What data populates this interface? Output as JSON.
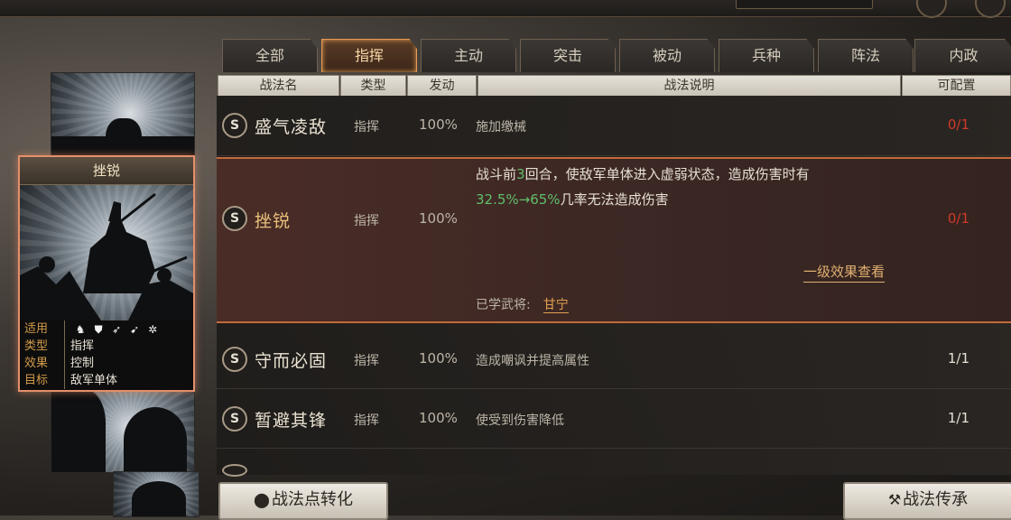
{
  "tabs": [
    {
      "label": "全部"
    },
    {
      "label": "指挥"
    },
    {
      "label": "主动"
    },
    {
      "label": "突击"
    },
    {
      "label": "被动"
    },
    {
      "label": "兵种"
    },
    {
      "label": "阵法"
    },
    {
      "label": "内政"
    }
  ],
  "active_tab": "指挥",
  "headers": {
    "name": "战法名",
    "type": "类型",
    "rate": "发动",
    "desc": "战法说明",
    "config": "可配置"
  },
  "card": {
    "title": "挫锐",
    "info": [
      {
        "label": "适用",
        "value": ""
      },
      {
        "label": "类型",
        "value": "指挥"
      },
      {
        "label": "效果",
        "value": "控制"
      },
      {
        "label": "目标",
        "value": "敌军单体"
      }
    ],
    "arm_icons": [
      "cavalry-icon",
      "shield-icon",
      "bow-icon",
      "spear-icon",
      "wheel-icon"
    ]
  },
  "skills": [
    {
      "grade": "S",
      "name": "盛气凌敌",
      "type": "指挥",
      "rate": "100%",
      "desc": "施加缴械",
      "config": "0/1",
      "config_color": "#d23a2a"
    },
    {
      "grade": "S",
      "name": "挫锐",
      "type": "指挥",
      "rate": "100%",
      "config": "0/1",
      "config_color": "#d23a2a"
    },
    {
      "grade": "S",
      "name": "守而必固",
      "type": "指挥",
      "rate": "100%",
      "desc": "造成嘲讽并提高属性",
      "config": "1/1",
      "config_color": "#e6e0d4"
    },
    {
      "grade": "S",
      "name": "暂避其锋",
      "type": "指挥",
      "rate": "100%",
      "desc": "使受到伤害降低",
      "config": "1/1",
      "config_color": "#e6e0d4"
    }
  ],
  "detail": {
    "line1_a": "战斗前",
    "line1_num": "3",
    "line1_b": "回合，使敌军单体进入虚弱状态，造成伤害时有",
    "line2_green": "32.5%→65%",
    "line2_rest": "几率无法造成伤害",
    "view_link": "一级效果查看",
    "learned_label": "已学武将:",
    "learned_general": "甘宁"
  },
  "buttons": {
    "convert": "战法点转化",
    "inherit": "战法传承"
  },
  "colors": {
    "accent_orange": "#e89a52",
    "config_red": "#d23a2a",
    "detail_green": "#5fbf6a"
  }
}
